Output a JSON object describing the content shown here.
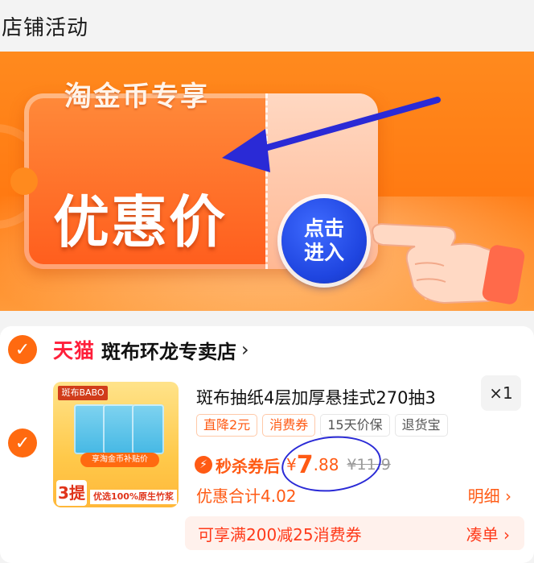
{
  "header": {
    "title": "店铺活动"
  },
  "banner": {
    "subtitle": "淘金币专享",
    "title": "优惠价",
    "enter_button_line1": "点击",
    "enter_button_line2": "进入"
  },
  "shop": {
    "platform_logo": "天猫",
    "name": "斑布环龙专卖店",
    "chevron": "›"
  },
  "product": {
    "title": "斑布抽纸4层加厚悬挂式270抽3",
    "quantity": "×1",
    "tags": [
      "直降2元",
      "消费券",
      "15天价保",
      "退货宝"
    ],
    "thumbnail": {
      "brand": "斑布BABO",
      "banner": "享淘金币补贴价",
      "count": "3提",
      "footer": "优选100%原生竹浆"
    },
    "deal_label": "秒杀券后",
    "price_currency": "¥",
    "price_integer": "7",
    "price_decimal": ".88",
    "original_price": "¥11.9",
    "discount_total": "优惠合计4.02",
    "details_link": "明细 ›"
  },
  "promo": {
    "text": "可享满200减25消费券",
    "link": "凑单 ›"
  },
  "colors": {
    "accent": "#ff5a14",
    "tmall_red": "#ff1f3a",
    "annotation_blue": "#2a2ad6",
    "banner_orange": "#ff7a12"
  },
  "icons": {
    "check": "check-icon",
    "bolt": "lightning-icon",
    "hand": "pointing-hand-icon",
    "arrow": "annotation-arrow-icon"
  }
}
